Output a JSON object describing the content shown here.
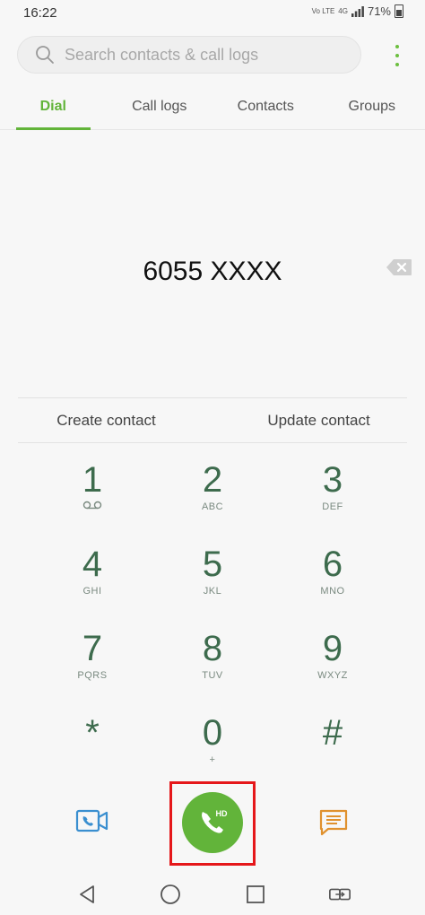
{
  "status_bar": {
    "time": "16:22",
    "volte_label": "Vo LTE",
    "network_label": "4G",
    "battery_percent": "71%"
  },
  "search": {
    "placeholder": "Search contacts & call logs",
    "value": ""
  },
  "tabs": [
    {
      "label": "Dial",
      "active": true
    },
    {
      "label": "Call logs",
      "active": false
    },
    {
      "label": "Contacts",
      "active": false
    },
    {
      "label": "Groups",
      "active": false
    }
  ],
  "dialed_number": "6055 XXXX",
  "contact_actions": {
    "create": "Create contact",
    "update": "Update contact"
  },
  "keypad": [
    {
      "digit": "1",
      "letters": ""
    },
    {
      "digit": "2",
      "letters": "ABC"
    },
    {
      "digit": "3",
      "letters": "DEF"
    },
    {
      "digit": "4",
      "letters": "GHI"
    },
    {
      "digit": "5",
      "letters": "JKL"
    },
    {
      "digit": "6",
      "letters": "MNO"
    },
    {
      "digit": "7",
      "letters": "PQRS"
    },
    {
      "digit": "8",
      "letters": "TUV"
    },
    {
      "digit": "9",
      "letters": "WXYZ"
    },
    {
      "digit": "*",
      "letters": ""
    },
    {
      "digit": "0",
      "letters": "+"
    },
    {
      "digit": "#",
      "letters": ""
    }
  ],
  "call_button": {
    "badge": "HD",
    "icon": "phone-icon"
  },
  "colors": {
    "accent_green": "#62b43a",
    "key_digit": "#3d6b4d",
    "highlight_red": "#e5171a",
    "video_icon": "#3a8fd0",
    "message_icon": "#e0912e"
  }
}
